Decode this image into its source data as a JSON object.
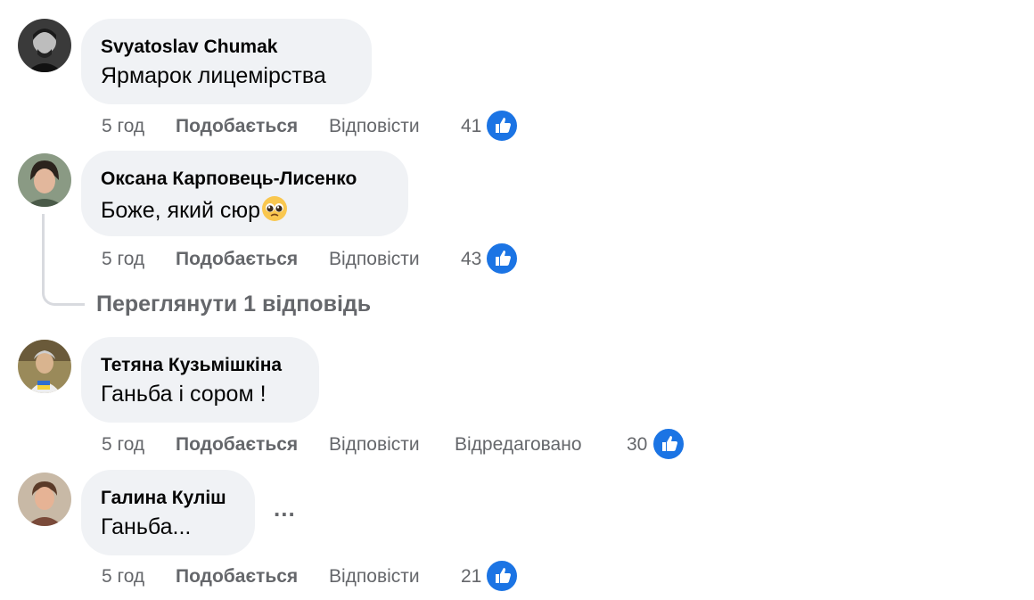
{
  "comments": [
    {
      "author": "Svyatoslav Chumak",
      "text": "Ярмарок лицемірства",
      "time": "5 год",
      "like_label": "Подобається",
      "reply_label": "Відповісти",
      "likes": "41"
    },
    {
      "author": "Оксана Карповець-Лисенко",
      "text": "Боже, який сюр",
      "emoji": "pleading-face-emoji",
      "time": "5 год",
      "like_label": "Подобається",
      "reply_label": "Відповісти",
      "likes": "43",
      "view_replies": "Переглянути 1 відповідь"
    },
    {
      "author": "Тетяна Кузьмішкіна",
      "text": "Ганьба і сором !",
      "time": "5 год",
      "like_label": "Подобається",
      "reply_label": "Відповісти",
      "edited_label": "Відредаговано",
      "likes": "30"
    },
    {
      "author": "Галина Куліш",
      "text": "Ганьба...",
      "time": "5 год",
      "like_label": "Подобається",
      "reply_label": "Відповісти",
      "likes": "21",
      "more_label": "..."
    }
  ],
  "colors": {
    "bubble": "#f0f2f5",
    "meta_text": "#65676b",
    "like_badge": "#1b74e4"
  },
  "icons": {
    "like": "thumbs-up-icon"
  }
}
